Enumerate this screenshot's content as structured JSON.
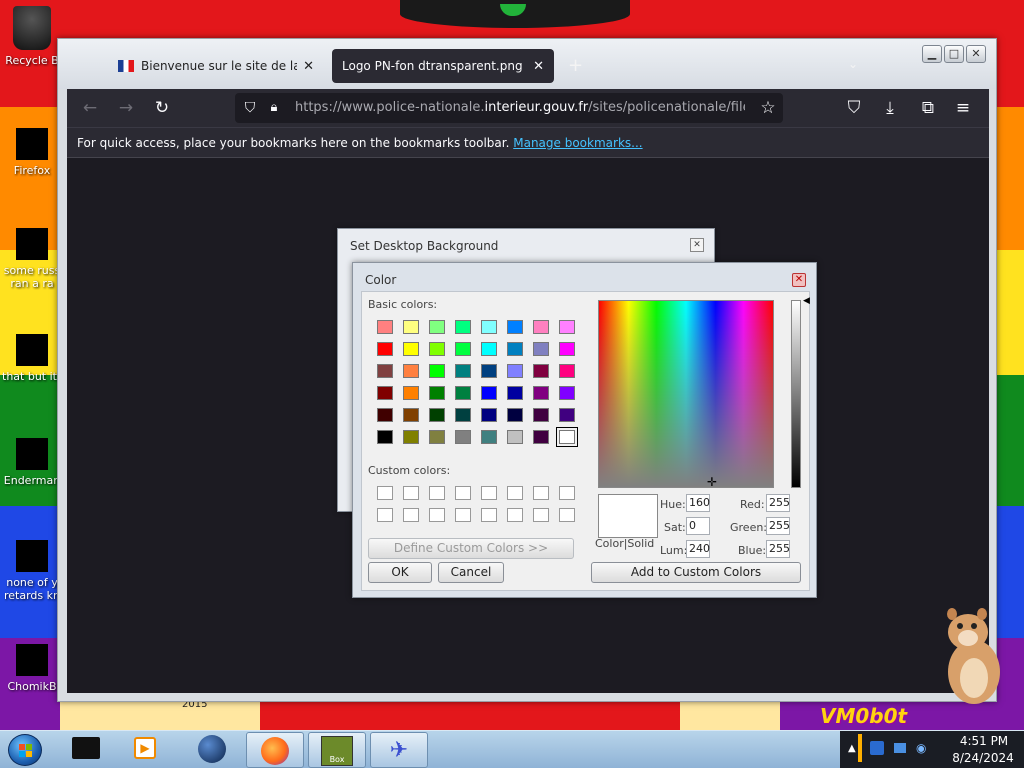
{
  "desktop": {
    "icons": [
      {
        "label": "Recycle B"
      },
      {
        "label": "Firefox"
      },
      {
        "label": "some russ"
      },
      {
        "label": "ran a ra"
      },
      {
        "label": "that but its"
      },
      {
        "label": "Enderman"
      },
      {
        "label": "none of y"
      },
      {
        "label": "retards kn"
      },
      {
        "label": "ChomikB"
      }
    ],
    "wallpaper_text": "VM0b0t",
    "wallpaper_small": "2015"
  },
  "browser": {
    "tabs": [
      {
        "label": "Bienvenue sur le site de la police",
        "close": "✕"
      },
      {
        "label": "Logo PN-fon dtransparent.png (PN",
        "close": "✕"
      }
    ],
    "url_prefix": "https://www.police-nationale.",
    "url_domain": "interieur.gouv.fr",
    "url_suffix": "/sites/policenationale/files/me",
    "bookmarks_text": "For quick access, place your bookmarks here on the bookmarks toolbar.",
    "bookmarks_link": "Manage bookmarks..."
  },
  "set_desktop_background": {
    "title": "Set Desktop Background"
  },
  "color_dialog": {
    "title": "Color",
    "basic_colors_label": "Basic colors:",
    "custom_colors_label": "Custom colors:",
    "define_custom_button": "Define Custom Colors >>",
    "ok_button": "OK",
    "cancel_button": "Cancel",
    "add_custom_button": "Add to Custom Colors",
    "color_solid_label": "Color|Solid",
    "hue_label": "Hue:",
    "sat_label": "Sat:",
    "lum_label": "Lum:",
    "red_label": "Red:",
    "green_label": "Green:",
    "blue_label": "Blue:",
    "hue": "160",
    "sat": "0",
    "lum": "240",
    "red": "255",
    "green": "255",
    "blue": "255",
    "basic_colors": [
      "#ff8080",
      "#ffff80",
      "#80ff80",
      "#00ff80",
      "#80ffff",
      "#0080ff",
      "#ff80c0",
      "#ff80ff",
      "#ff0000",
      "#ffff00",
      "#80ff00",
      "#00ff40",
      "#00ffff",
      "#0080c0",
      "#8080c0",
      "#ff00ff",
      "#804040",
      "#ff8040",
      "#00ff00",
      "#008080",
      "#004080",
      "#8080ff",
      "#800040",
      "#ff0080",
      "#800000",
      "#ff8000",
      "#008000",
      "#008040",
      "#0000ff",
      "#0000a0",
      "#800080",
      "#8000ff",
      "#400000",
      "#804000",
      "#004000",
      "#004040",
      "#000080",
      "#000040",
      "#400040",
      "#400080",
      "#000000",
      "#808000",
      "#808040",
      "#808080",
      "#408080",
      "#c0c0c0",
      "#400040",
      "#ffffff"
    ],
    "selected_index": 47
  },
  "taskbar": {
    "time": "4:51 PM",
    "date": "8/24/2024",
    "box_label": "Box"
  }
}
